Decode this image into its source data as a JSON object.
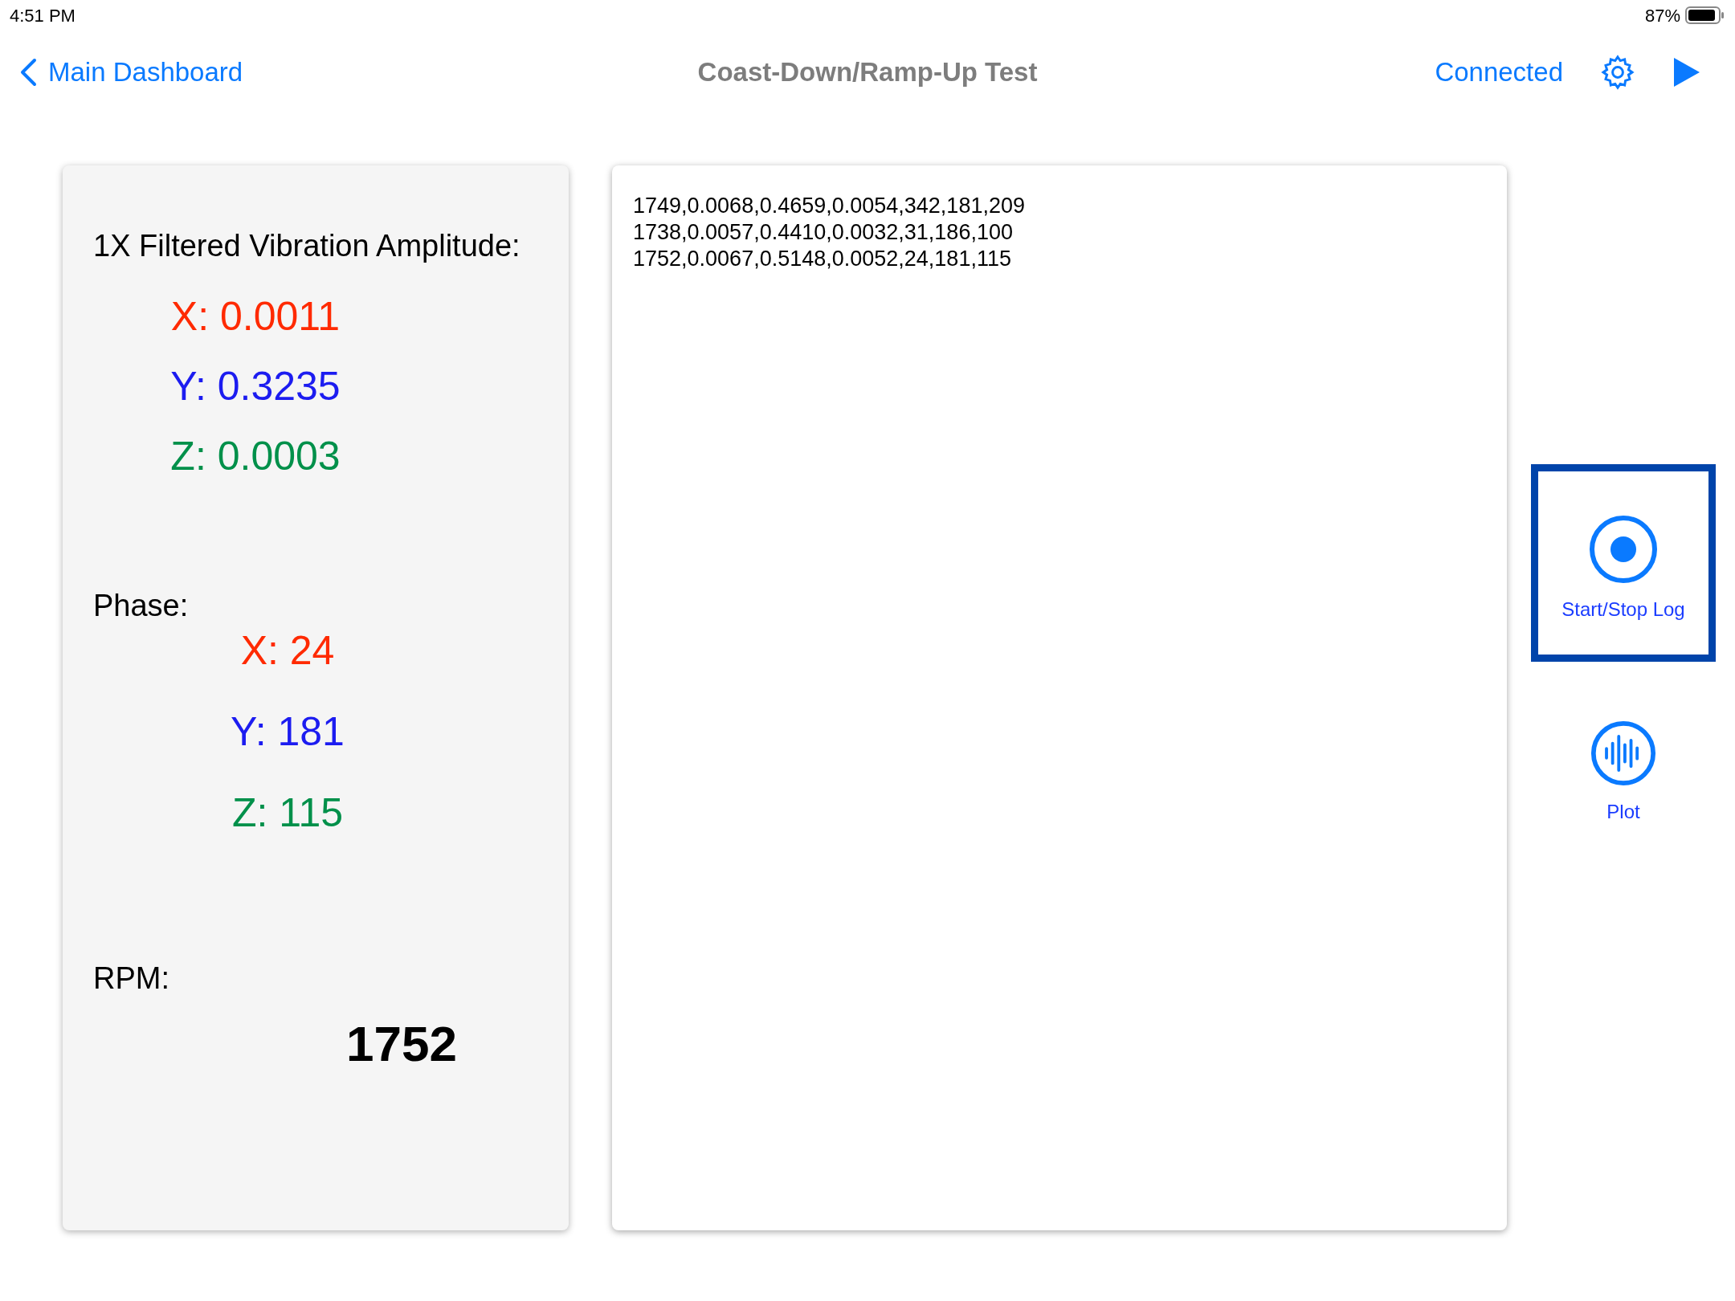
{
  "status_bar": {
    "time": "4:51 PM",
    "battery": "87%"
  },
  "nav": {
    "back": "Main Dashboard",
    "title": "Coast-Down/Ramp-Up Test",
    "connection": "Connected"
  },
  "amplitude": {
    "title": "1X Filtered Vibration Amplitude:",
    "values": [
      {
        "text": "X: 0.0011",
        "color": "#ff2a00"
      },
      {
        "text": "Y: 0.3235",
        "color": "#1c1cf0"
      },
      {
        "text": "Z: 0.0003",
        "color": "#00904a"
      }
    ]
  },
  "phase": {
    "title": "Phase:",
    "values": [
      {
        "text": "X: 24",
        "color": "#ff2a00"
      },
      {
        "text": "Y: 181",
        "color": "#1c1cf0"
      },
      {
        "text": "Z: 115",
        "color": "#00904a"
      }
    ]
  },
  "rpm": {
    "title": "RPM:",
    "value": "1752"
  },
  "log_lines": [
    "1749,0.0068,0.4659,0.0054,342,181,209",
    "1738,0.0057,0.4410,0.0032,31,186,100",
    "1752,0.0067,0.5148,0.0052,24,181,115"
  ],
  "side_buttons": [
    {
      "kind": "record",
      "label": "Start/Stop Log",
      "selected": true
    },
    {
      "kind": "waveform",
      "label": "Plot",
      "selected": false
    }
  ]
}
